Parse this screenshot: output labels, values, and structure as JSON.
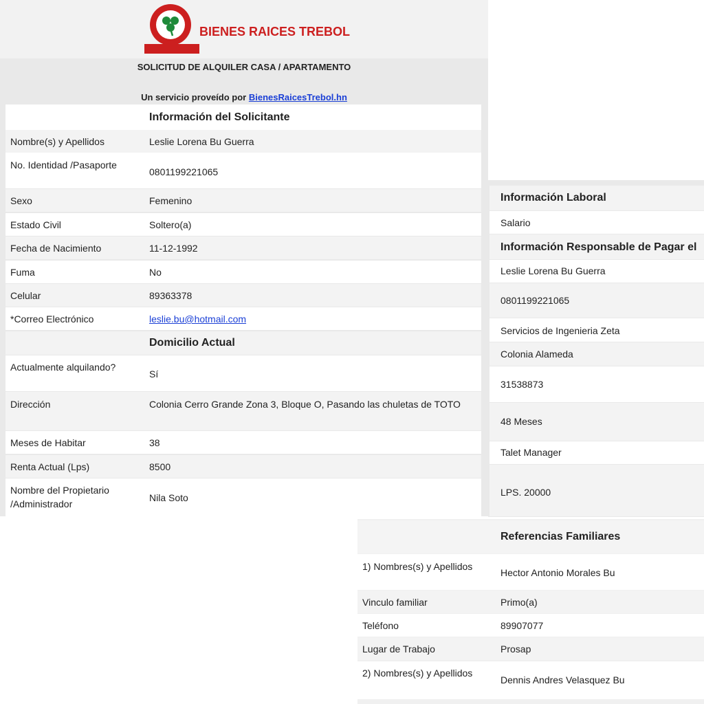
{
  "header": {
    "brand": "BIENES RAICES TREBOL",
    "brand_color": "#cc1f1f",
    "clover_color": "#1e8a3a",
    "title": "SOLICITUD DE ALQUILER CASA / APARTAMENTO",
    "subtitle_prefix": "Un servicio proveído por ",
    "subtitle_link": "BienesRaicesTrebol.hn"
  },
  "applicant": {
    "section_title": "Información del Solicitante",
    "rows": [
      {
        "label": "Nombre(s) y Apellidos",
        "value": "Leslie Lorena Bu Guerra"
      },
      {
        "label": "No. Identidad /Pasaporte",
        "value": "0801199221065"
      },
      {
        "label": "Sexo",
        "value": "Femenino"
      },
      {
        "label": "Estado Civil",
        "value": "Soltero(a)"
      },
      {
        "label": "Fecha de Nacimiento",
        "value": "11-12-1992"
      },
      {
        "label": "Fuma",
        "value": "No"
      },
      {
        "label": "Celular",
        "value": "89363378"
      },
      {
        "label": "*Correo Electrónico",
        "value": "leslie.bu@hotmail.com"
      }
    ]
  },
  "residence": {
    "section_title": "Domicilio Actual",
    "rows": [
      {
        "label": "Actualmente alquilando?",
        "value": "Sí"
      },
      {
        "label": "Dirección",
        "value": "Colonia Cerro Grande Zona 3,  Bloque O, Pasando las chuletas de TOTO"
      },
      {
        "label": "Meses de Habitar",
        "value": "38"
      },
      {
        "label": "Renta Actual (Lps)",
        "value": "8500"
      },
      {
        "label": "Nombre del Propietario /Administrador",
        "value": "Nila Soto"
      }
    ]
  },
  "work": {
    "section_title": "Información Laboral",
    "salary_label": "Salario",
    "payer_title": "Información Responsable de Pagar el",
    "values": [
      "Leslie Lorena Bu Guerra",
      "0801199221065",
      "Servicios de Ingenieria Zeta",
      "Colonia Alameda",
      "31538873",
      "48 Meses",
      "Talet Manager",
      "LPS. 20000"
    ]
  },
  "family": {
    "section_title": "Referencias Familiares",
    "rows": [
      {
        "label": "1) Nombres(s) y Apellidos",
        "value": "Hector Antonio Morales Bu"
      },
      {
        "label": "Vinculo familiar",
        "value": "Primo(a)"
      },
      {
        "label": "Teléfono",
        "value": "89907077"
      },
      {
        "label": "Lugar de Trabajo",
        "value": "Prosap"
      },
      {
        "label": "2) Nombres(s) y Apellidos",
        "value": "Dennis Andres Velasquez Bu"
      }
    ]
  }
}
